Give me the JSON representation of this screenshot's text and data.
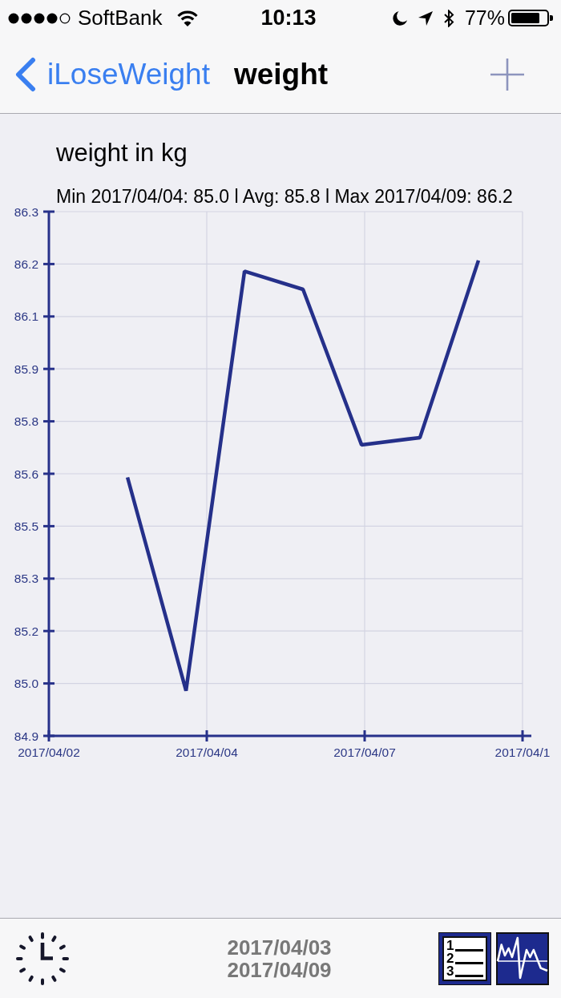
{
  "status_bar": {
    "carrier": "SoftBank",
    "time": "10:13",
    "battery": "77%"
  },
  "nav_bar": {
    "back_label": "iLoseWeight",
    "title": "weight"
  },
  "chart": {
    "summary": "Min 2017/04/04: 85.0 l Avg: 85.8 l Max 2017/04/09: 86.2",
    "x_axis_labels": [
      "2017/04/02",
      "2017/04/04",
      "2017/04/07",
      "2017/04/1"
    ],
    "chart_data": {
      "type": "line",
      "title": "weight in kg",
      "grid": true,
      "categories": [
        null,
        null,
        null,
        null,
        null,
        null,
        null
      ],
      "series": [
        {
          "color": "#25308a",
          "values": [
            85.61,
            85.02,
            86.18,
            86.13,
            85.7,
            85.72,
            86.21
          ]
        }
      ],
      "ylim": [
        84.895,
        86.345
      ],
      "yticks": [
        {
          "value": 84.895,
          "label": "84.9"
        },
        {
          "value": 85.04,
          "label": "85.0"
        },
        {
          "value": 85.185,
          "label": "85.2"
        },
        {
          "value": 85.33,
          "label": "85.3"
        },
        {
          "value": 85.475,
          "label": "85.5"
        },
        {
          "value": 85.62,
          "label": "85.6"
        },
        {
          "value": 85.765,
          "label": "85.8"
        },
        {
          "value": 85.91,
          "label": "85.9"
        },
        {
          "value": 86.055,
          "label": "86.1"
        },
        {
          "value": 86.2,
          "label": "86.2"
        },
        {
          "value": 86.345,
          "label": "86.3"
        }
      ]
    }
  },
  "toolbar": {
    "date_range": [
      "2017/04/03",
      "2017/04/09"
    ],
    "list_button": {
      "numbers": [
        "1",
        "2",
        "3"
      ]
    }
  }
}
